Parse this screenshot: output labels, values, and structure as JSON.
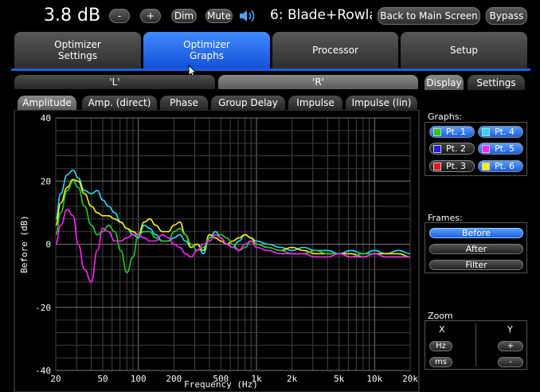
{
  "header": {
    "volume": "3.8 dB",
    "minus": "-",
    "plus": "+",
    "dim": "Dim",
    "mute": "Mute",
    "preset": "6: Blade+Rowla",
    "back": "Back to Main Screen",
    "bypass": "Bypass"
  },
  "main_tabs": [
    {
      "line1": "Optimizer",
      "line2": "Settings"
    },
    {
      "line1": "Optimizer",
      "line2": "Graphs"
    },
    {
      "line1": "Processor",
      "line2": ""
    },
    {
      "line1": "Setup",
      "line2": ""
    }
  ],
  "channels": {
    "left": "'L'",
    "right": "'R'"
  },
  "graph_tabs": [
    "Amplitude",
    "Amp. (direct)",
    "Phase",
    "Group Delay",
    "Impulse",
    "Impulse (lin)"
  ],
  "side_tabs": {
    "display": "Display",
    "settings": "Settings"
  },
  "graphs_panel": {
    "title": "Graphs:",
    "points": [
      {
        "label": "Pt. 1",
        "color": "#22cc22"
      },
      {
        "label": "Pt. 4",
        "color": "#22ddff"
      },
      {
        "label": "Pt. 2",
        "color": "#1a1aff"
      },
      {
        "label": "Pt. 5",
        "color": "#ff22ff"
      },
      {
        "label": "Pt. 3",
        "color": "#ee1111"
      },
      {
        "label": "Pt. 6",
        "color": "#ffee00"
      }
    ]
  },
  "frames_panel": {
    "title": "Frames:",
    "before": "Before",
    "after": "After",
    "filter": "Filter"
  },
  "zoom_panel": {
    "title": "Zoom",
    "x": "X",
    "y": "Y",
    "hz": "Hz",
    "ms": "ms",
    "plus": "+",
    "minus": "-"
  },
  "chart_data": {
    "type": "line",
    "xlabel": "Frequency (Hz)",
    "ylabel": "Before (dB)",
    "x_scale": "log",
    "xlim": [
      20,
      20000
    ],
    "ylim": [
      -40,
      40
    ],
    "x_ticks": [
      "20",
      "50",
      "100",
      "200",
      "500",
      "1k",
      "2k",
      "5k",
      "10k",
      "20k"
    ],
    "x_tick_values": [
      20,
      50,
      100,
      200,
      500,
      1000,
      2000,
      5000,
      10000,
      20000
    ],
    "y_ticks": [
      "40",
      "20",
      "0",
      "-20",
      "-40"
    ],
    "y_tick_values": [
      40,
      20,
      0,
      -20,
      -40
    ],
    "grid": true,
    "series": [
      {
        "color": "#22ddff",
        "x": [
          20,
          22,
          25,
          28,
          31,
          35,
          40,
          45,
          50,
          56,
          63,
          71,
          80,
          90,
          100,
          112,
          125,
          140,
          160,
          180,
          200,
          225,
          250,
          280,
          315,
          355,
          400,
          450,
          500,
          560,
          630,
          710,
          800,
          900,
          1000,
          1250,
          1600,
          2000,
          2500,
          3150,
          4000,
          5000,
          6300,
          8000,
          10000,
          12500,
          16000,
          20000
        ],
        "y": [
          8,
          16,
          22,
          23.5,
          21,
          17,
          16,
          17,
          14,
          12,
          10,
          7,
          5,
          3,
          2,
          6,
          5,
          3,
          1,
          1,
          2,
          3,
          1,
          -1,
          0,
          -3,
          2,
          4,
          2,
          0,
          -1,
          1,
          3,
          2,
          1,
          0,
          -1,
          -2,
          -1,
          -2,
          -2,
          -3,
          -2,
          -3,
          -2,
          -3,
          -2,
          -3
        ]
      },
      {
        "color": "#ffee00",
        "x": [
          20,
          22,
          25,
          28,
          31,
          35,
          40,
          45,
          50,
          56,
          63,
          71,
          80,
          90,
          100,
          112,
          125,
          140,
          160,
          180,
          200,
          225,
          250,
          280,
          315,
          355,
          400,
          450,
          500,
          560,
          630,
          710,
          800,
          900,
          1000,
          1250,
          1600,
          2000,
          2500,
          3150,
          4000,
          5000,
          6300,
          8000,
          10000,
          12500,
          16000,
          20000
        ],
        "y": [
          6,
          13,
          18,
          20.5,
          20,
          16,
          12,
          10,
          9,
          9,
          8,
          7,
          5,
          4,
          3,
          7,
          8,
          6,
          4,
          4,
          6,
          7,
          3,
          -1,
          0,
          -2,
          3,
          2,
          1,
          0,
          1,
          2,
          3,
          2,
          0,
          -1,
          -2,
          -1,
          -2,
          -3,
          -3,
          -3,
          -3,
          -4,
          -3,
          -3,
          -3,
          -4
        ]
      },
      {
        "color": "#22cc22",
        "x": [
          20,
          22,
          25,
          28,
          31,
          35,
          40,
          45,
          50,
          56,
          63,
          71,
          80,
          90,
          100,
          112,
          125,
          140,
          160,
          180,
          200,
          225,
          250,
          280,
          315,
          355,
          400,
          450,
          500,
          560,
          630,
          710,
          800,
          900,
          1000,
          1250,
          1600,
          2000,
          2500,
          3150,
          4000,
          5000,
          6300,
          8000,
          10000,
          12500,
          16000,
          20000
        ],
        "y": [
          3,
          10,
          17,
          20,
          18,
          12,
          6,
          3,
          4,
          6,
          4,
          -2,
          -9,
          -4,
          3,
          4,
          4,
          2,
          1,
          1,
          4,
          5,
          3,
          0,
          -2,
          -1,
          2,
          3,
          3,
          2,
          0,
          -2,
          -1,
          1,
          0,
          -1,
          -2,
          -3,
          -3,
          -2,
          -3,
          -3,
          -4,
          -3,
          -3,
          -4,
          -4,
          -4
        ]
      },
      {
        "color": "#ff22ff",
        "x": [
          20,
          22,
          25,
          28,
          31,
          35,
          40,
          45,
          50,
          56,
          63,
          71,
          80,
          90,
          100,
          112,
          125,
          140,
          160,
          180,
          200,
          225,
          250,
          280,
          315,
          355,
          400,
          450,
          500,
          560,
          630,
          710,
          800,
          900,
          1000,
          1250,
          1600,
          2000,
          2500,
          3150,
          4000,
          5000,
          6300,
          8000,
          10000,
          12500,
          16000,
          20000
        ],
        "y": [
          0,
          6,
          11,
          9,
          0,
          -8,
          -12,
          -2,
          5,
          4,
          1,
          1,
          2,
          3,
          3,
          2,
          1,
          1,
          3,
          2,
          0,
          -1,
          -3,
          -4,
          -2,
          0,
          1,
          3,
          2,
          0,
          -1,
          -2,
          0,
          1,
          -1,
          -2,
          -3,
          -3,
          -3,
          -4,
          -4,
          -3,
          -4,
          -4,
          -3,
          -4,
          -4,
          -4
        ]
      }
    ]
  }
}
